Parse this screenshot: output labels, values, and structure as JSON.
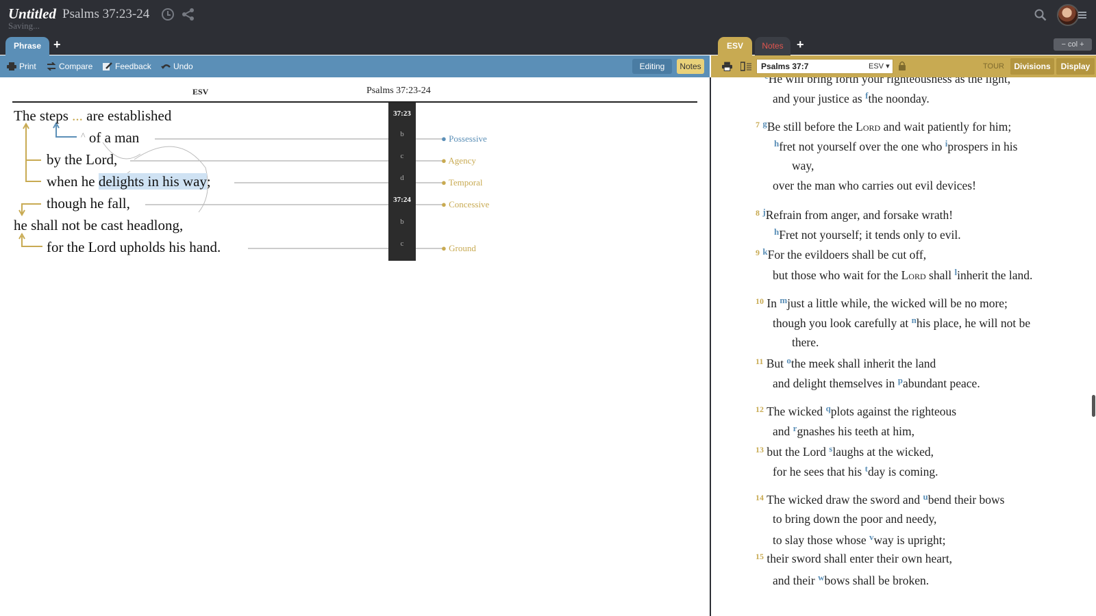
{
  "header": {
    "title": "Untitled",
    "reference": "Psalms 37:23-24",
    "status": "Saving..."
  },
  "tabs": {
    "left": [
      {
        "label": "Phrase"
      }
    ],
    "right": [
      {
        "label": "ESV"
      },
      {
        "label": "Notes"
      }
    ],
    "add": "+",
    "col_control": "− col +"
  },
  "left_toolbar": {
    "print": "Print",
    "compare": "Compare",
    "feedback": "Feedback",
    "undo": "Undo",
    "editing": "Editing",
    "notes": "Notes"
  },
  "right_toolbar": {
    "reference": "Psalms 37:7",
    "version": "ESV ▾",
    "tour": "TOUR",
    "divisions": "Divisions",
    "display": "Display"
  },
  "phrase": {
    "version": "ESV",
    "reference": "Psalms 37:23-24",
    "lines": [
      {
        "pre": "The steps ",
        "ellipsis": "...",
        "post": " are established"
      },
      {
        "caret": "^",
        "text": "of a man"
      },
      {
        "text": "by the Lord,"
      },
      {
        "pre": "when he ",
        "highlight": "delights in his way",
        "post": ";"
      },
      {
        "text": "though he fall,"
      },
      {
        "text": "he shall not be cast headlong,"
      },
      {
        "text": "for the Lord upholds his hand."
      }
    ],
    "verse_markers": [
      "37:23",
      "b",
      "c",
      "d",
      "37:24",
      "b",
      "c"
    ],
    "relationships": [
      {
        "label": "Possessive",
        "color": "#5b8fb7"
      },
      {
        "label": "Agency",
        "color": "#c8aa52"
      },
      {
        "label": "Temporal",
        "color": "#c8aa52"
      },
      {
        "label": "Concessive",
        "color": "#c8aa52"
      },
      {
        "label": "Ground",
        "color": "#c8aa52"
      }
    ]
  },
  "reader": {
    "lines": [
      {
        "fn": "e",
        "text": "He will bring forth your righteousness as the light,"
      },
      {
        "pre": "and your justice as ",
        "fn": "f",
        "text": "the noonday."
      },
      {
        "vn": "7",
        "fn": "g",
        "pre": "Be still before the ",
        "sc": "Lord",
        "text": " and wait patiently for him;"
      },
      {
        "fn": "h",
        "text": "fret not yourself over the one who "
      },
      {
        "fn": "i",
        "text": "prospers in his"
      },
      {
        "text": "way,"
      },
      {
        "text": "over the man who carries out evil devices!"
      },
      {
        "vn": "8",
        "fn": "j",
        "text": "Refrain from anger, and forsake wrath!"
      },
      {
        "fn": "h",
        "text": "Fret not yourself; it tends only to evil."
      },
      {
        "vn": "9",
        "fn": "k",
        "text": "For the evildoers shall be cut off,"
      },
      {
        "pre": "but those who wait for the ",
        "sc": "Lord",
        "mid": " shall ",
        "fn": "l",
        "text": "inherit the land."
      },
      {
        "vn": "10",
        "pre": "In ",
        "fn": "m",
        "text": "just a little while, the wicked will be no more;"
      },
      {
        "pre": "though you look carefully at ",
        "fn": "n",
        "text": "his place, he will not be"
      },
      {
        "text": "there."
      },
      {
        "vn": "11",
        "pre": "But ",
        "fn": "o",
        "text": "the meek shall inherit the land"
      },
      {
        "pre": "and delight themselves in ",
        "fn": "p",
        "text": "abundant peace."
      },
      {
        "vn": "12",
        "pre": "The wicked ",
        "fn": "q",
        "text": "plots against the righteous"
      },
      {
        "pre": "and ",
        "fn": "r",
        "text": "gnashes his teeth at him,"
      },
      {
        "vn": "13",
        "pre": "but the Lord ",
        "fn": "s",
        "text": "laughs at the wicked,"
      },
      {
        "pre": "for he sees that his ",
        "fn": "t",
        "text": "day is coming."
      },
      {
        "vn": "14",
        "pre": "The wicked draw the sword and ",
        "fn": "u",
        "text": "bend their bows"
      },
      {
        "text": "to bring down the poor and needy,"
      },
      {
        "pre": "to slay those whose ",
        "fn": "v",
        "text": "way is upright;"
      },
      {
        "vn": "15",
        "text": "their sword shall enter their own heart,"
      },
      {
        "pre": "and their ",
        "fn": "w",
        "text": "bows shall be broken."
      }
    ]
  },
  "colors": {
    "topbar": "#2d2f35",
    "phrase_blue": "#5b8fb7",
    "esv_gold": "#c8aa52",
    "highlight": "#cfe2f3"
  }
}
